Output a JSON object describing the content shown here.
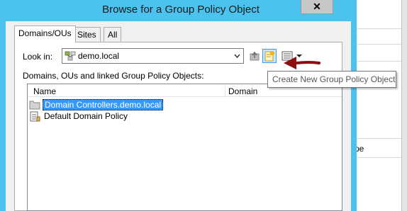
{
  "window": {
    "title": "Browse for a Group Policy Object",
    "close_glyph": "✕"
  },
  "tabs": [
    {
      "label": "Domains/OUs"
    },
    {
      "label": "Sites"
    },
    {
      "label": "All"
    }
  ],
  "look_in": {
    "label": "Look in:",
    "value": "demo.local"
  },
  "list": {
    "label": "Domains, OUs and linked Group Policy Objects:",
    "columns": [
      "Name",
      "Domain"
    ],
    "rows": [
      {
        "name": "Domain Controllers.demo.local",
        "domain": ""
      },
      {
        "name": "Default Domain Policy",
        "domain": ""
      }
    ]
  },
  "tooltip": {
    "text": "Create New Group Policy Object"
  },
  "background": {
    "partial_text": "pe"
  },
  "colors": {
    "title_bar": "#4cc2ee",
    "selection": "#3399ff",
    "arrow": "#8b0f10"
  }
}
